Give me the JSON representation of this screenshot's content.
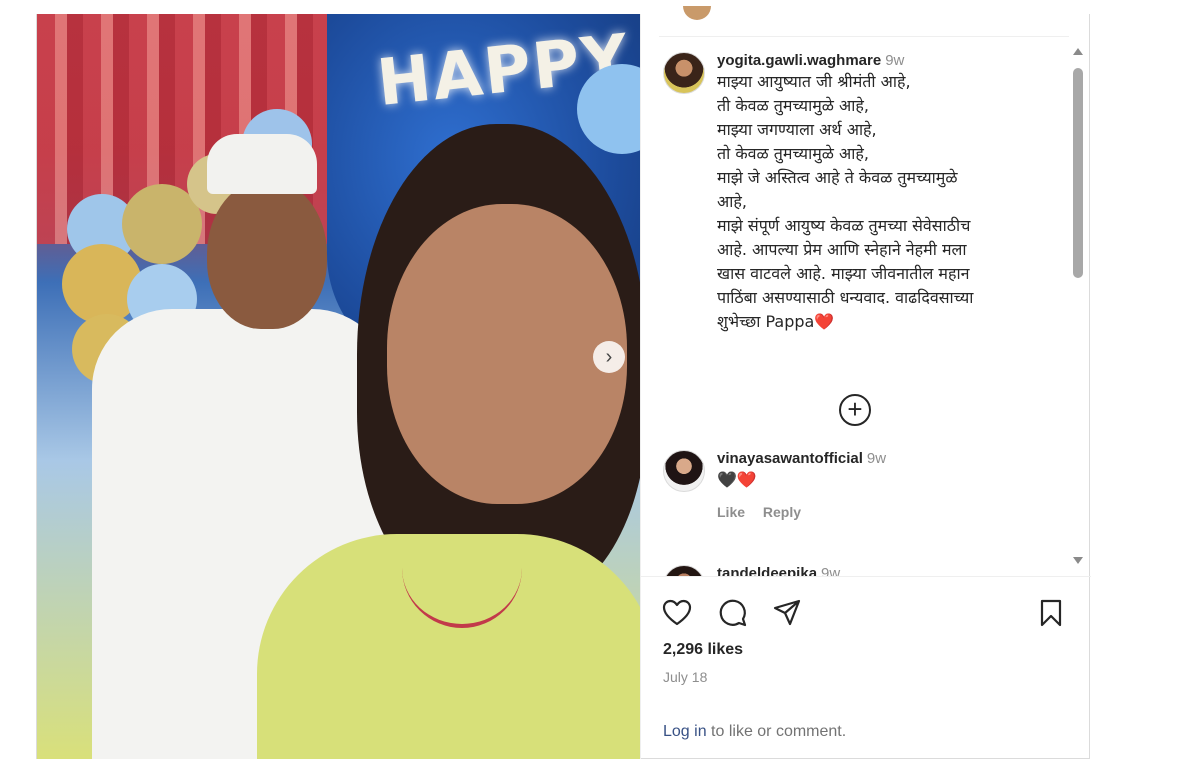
{
  "post": {
    "photo_text": "HAPPY",
    "comments": [
      {
        "username": "yogita.gawli.waghmare",
        "time": "9w",
        "text": "माझ्या आयुष्यात जी श्रीमंती आहे,\nती केवळ तुमच्यामुळे आहे,\nमाझ्या जगण्याला अर्थ आहे,\nतो केवळ तुमच्यामुळे आहे,\nमाझे जे अस्तित्व आहे ते केवळ तुमच्यामुळे\nआहे,\nमाझे संपूर्ण आयुष्य केवळ तुमच्या सेवेसाठीच\nआहे. आपल्या प्रेम आणि स्नेहाने नेहमी मला\nखास वाटवले आहे. माझ्या जीवनातील महान\nपाठिंबा असण्यासाठी धन्यवाद. वाढदिवसाच्या\nशुभेच्छा Pappa",
        "emoji": "❤️"
      },
      {
        "username": "vinayasawantofficial",
        "time": "9w",
        "text": "🖤",
        "emoji": "❤️",
        "like_label": "Like",
        "reply_label": "Reply"
      },
      {
        "username": "tandeldeepika",
        "time": "9w"
      }
    ],
    "likes": "2,296 likes",
    "date": "July 18",
    "login_link": "Log in",
    "login_rest": " to like or comment."
  },
  "icons": {
    "next": "chevron-right-icon",
    "load_more": "plus-circle-icon",
    "like": "heart-icon",
    "comment": "comment-icon",
    "share": "send-icon",
    "save": "bookmark-icon"
  },
  "colors": {
    "link": "#385185",
    "muted": "#8e8e8e",
    "heart": "#ed4956"
  }
}
